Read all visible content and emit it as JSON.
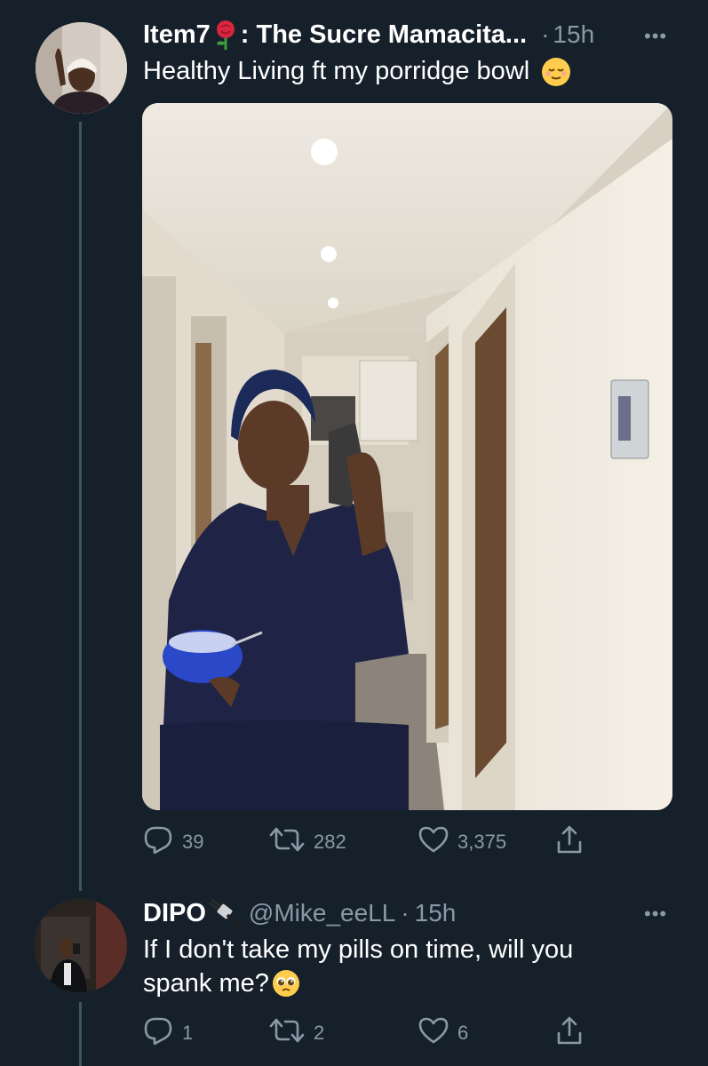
{
  "tweet": {
    "author_name": "Item7",
    "author_name_rest": ": The Sucre Mamacita...",
    "time": "15h",
    "dot": "·",
    "text": "Healthy Living ft my porridge bowl",
    "emoji": "relieved-face",
    "stats": {
      "replies": "39",
      "retweets": "282",
      "likes": "3,375"
    }
  },
  "reply": {
    "author_name": "DIPO",
    "handle": "@Mike_eeLL",
    "dot": "·",
    "time": "15h",
    "text_line1": "If I don't take my pills on time, will you",
    "text_line2": "spank me?",
    "emoji": "pleading-face",
    "stats": {
      "replies": "1",
      "retweets": "2",
      "likes": "6"
    }
  },
  "more_label": "•••",
  "colors": {
    "background": "#15202b",
    "muted": "#8b98a5",
    "thread_line": "#3d5466"
  }
}
